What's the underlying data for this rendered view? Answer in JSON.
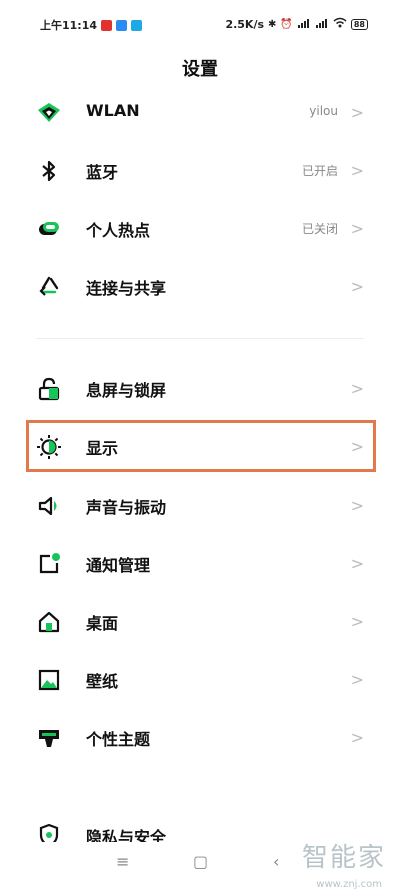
{
  "status": {
    "time": "上午11:14",
    "speed": "2.5K/s",
    "battery": "88"
  },
  "title": "设置",
  "rows": [
    {
      "label": "WLAN",
      "value": "yilou"
    },
    {
      "label": "蓝牙",
      "value": "已开启"
    },
    {
      "label": "个人热点",
      "value": "已关闭"
    },
    {
      "label": "连接与共享",
      "value": ""
    },
    {
      "label": "息屏与锁屏",
      "value": ""
    },
    {
      "label": "显示",
      "value": ""
    },
    {
      "label": "声音与振动",
      "value": ""
    },
    {
      "label": "通知管理",
      "value": ""
    },
    {
      "label": "桌面",
      "value": ""
    },
    {
      "label": "壁纸",
      "value": ""
    },
    {
      "label": "个性主题",
      "value": ""
    },
    {
      "label": "隐私与安全",
      "value": ""
    }
  ],
  "icons": [
    "wifi-icon",
    "bluetooth-icon",
    "hotspot-icon",
    "share-icon",
    "lock-icon",
    "display-icon",
    "sound-icon",
    "notification-icon",
    "home-icon",
    "wallpaper-icon",
    "theme-icon",
    "privacy-icon"
  ],
  "colors": {
    "accent": "#18c45a",
    "highlight": "#e2794c"
  },
  "watermark": {
    "cn": "智能家",
    "url": "www.znj.com"
  }
}
